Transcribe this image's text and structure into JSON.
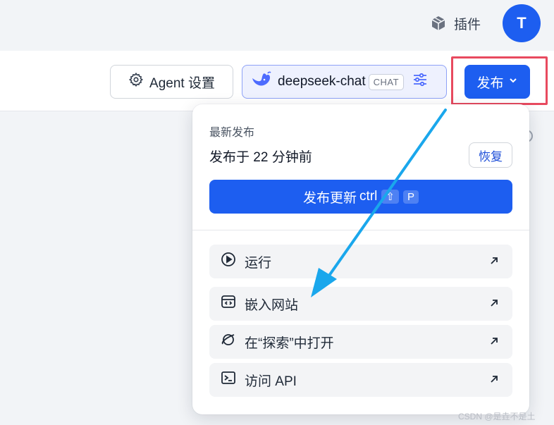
{
  "topbar": {
    "plugins_label": "插件",
    "plugins_icon": "package-icon",
    "avatar_letter": "T"
  },
  "toolbar": {
    "agent_settings_label": "Agent 设置",
    "model": {
      "name": "deepseek-chat",
      "tag": "CHAT"
    },
    "publish_label": "发布"
  },
  "dropdown": {
    "latest_label": "最新发布",
    "published_at": "发布于 22 分钟前",
    "restore_label": "恢复",
    "update_label": "发布更新",
    "shortcut": {
      "ctrl": "ctrl",
      "shift": "⇧",
      "key": "P"
    },
    "items": [
      {
        "label": "运行",
        "icon": "play-circle-icon"
      },
      {
        "label": "嵌入网站",
        "icon": "embed-code-icon"
      },
      {
        "label": "在“探索”中打开",
        "icon": "planet-icon"
      },
      {
        "label": "访问 API",
        "icon": "terminal-icon"
      }
    ]
  },
  "watermark": "CSDN @是垚不是土",
  "colors": {
    "primary": "#1d5ef0",
    "highlight": "#e84a5f",
    "annotation_arrow": "#1aa7ec",
    "model_bg": "#eef1fe"
  }
}
